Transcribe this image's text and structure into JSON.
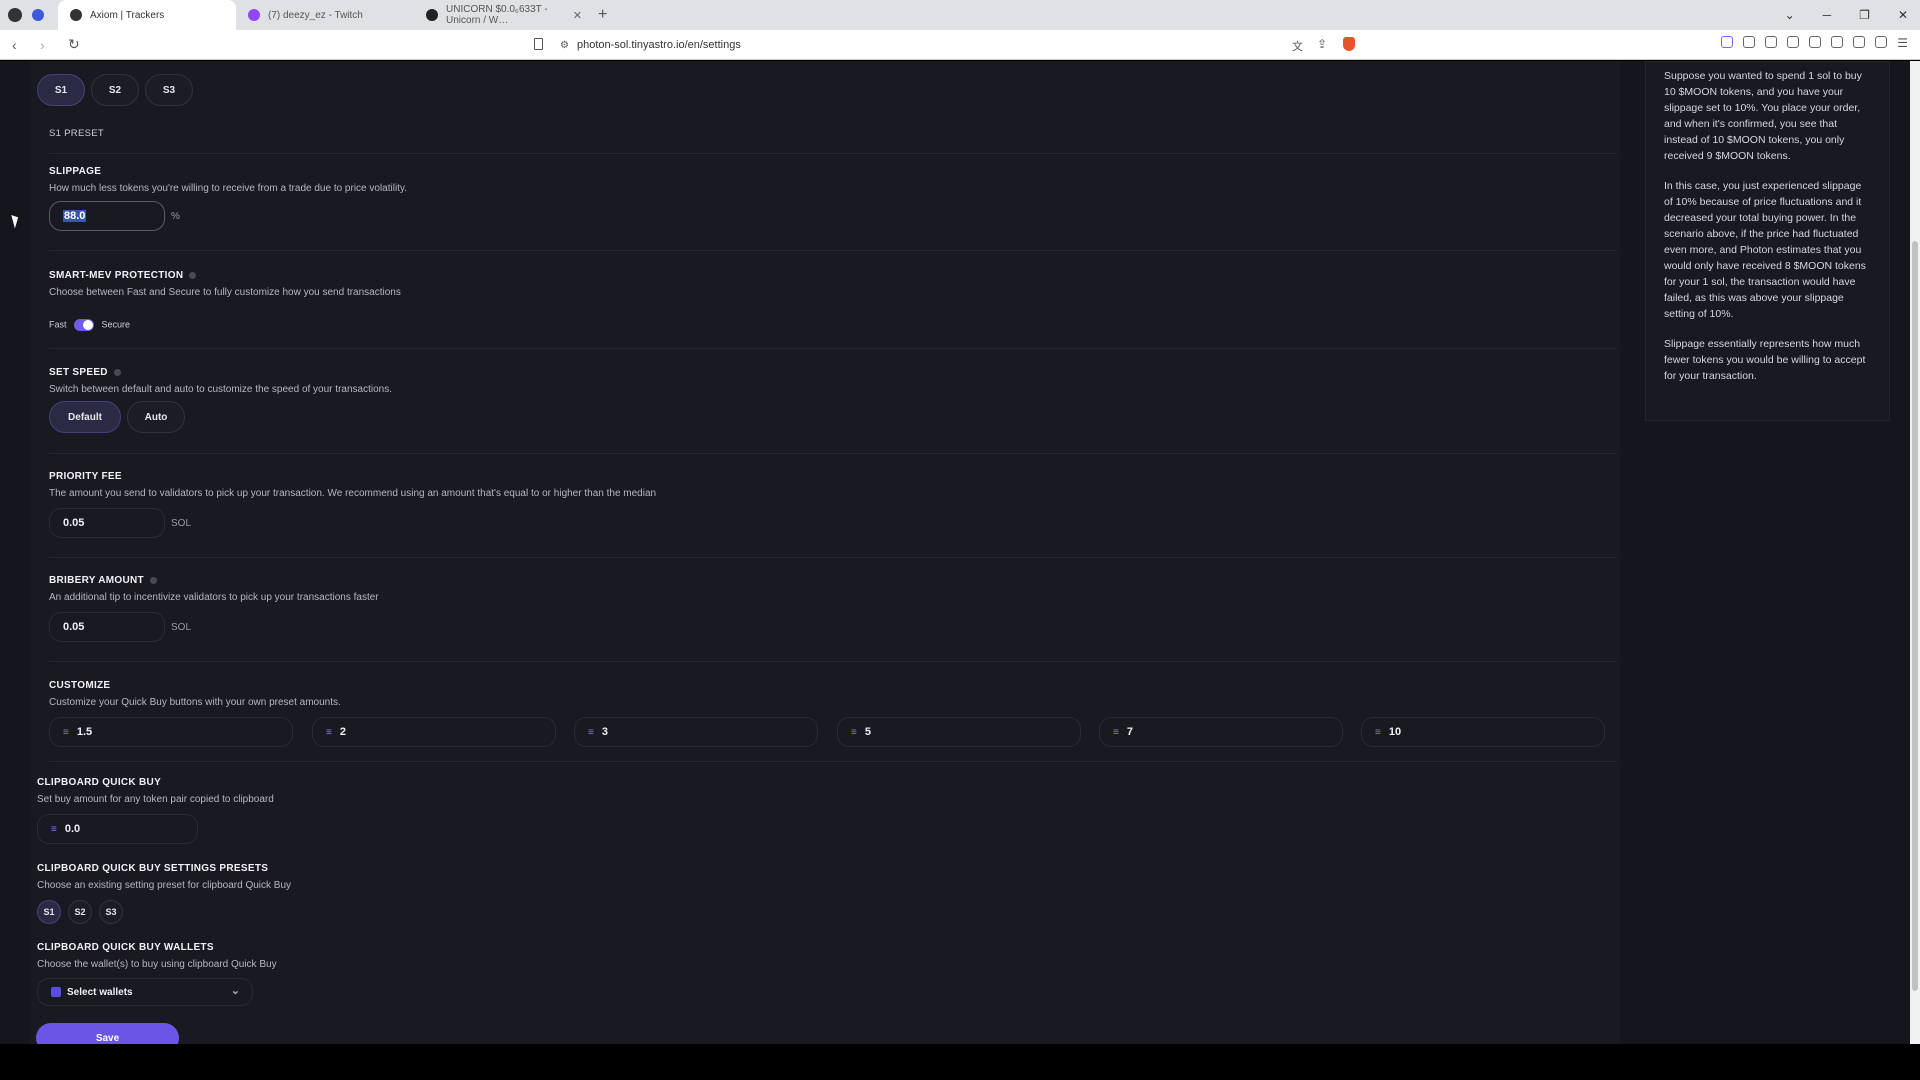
{
  "browser": {
    "tabs": [
      {
        "title": "Axiom | Trackers",
        "favicon_color": "#333333"
      },
      {
        "title": "(7) deezy_ez - Twitch",
        "favicon_color": "#9146ff"
      },
      {
        "title": "UNICORN $0.0₆633T - Unicorn / W…",
        "favicon_color": "#222222"
      }
    ],
    "url": "photon-sol.tinyastro.io/en/settings"
  },
  "presets": {
    "items": [
      "S1",
      "S2",
      "S3"
    ],
    "selected": "S1",
    "current_label": "S1 PRESET"
  },
  "slippage": {
    "title": "SLIPPAGE",
    "desc": "How much less tokens you're willing to receive from a trade due to price volatility.",
    "value": "88.0",
    "unit": "%"
  },
  "mev": {
    "title": "SMART-MEV PROTECTION",
    "desc": "Choose between Fast and Secure to fully customize how you send transactions",
    "left_label": "Fast",
    "right_label": "Secure",
    "mode": "Secure"
  },
  "speed": {
    "title": "SET SPEED",
    "desc": "Switch between default and auto to customize the speed of your transactions.",
    "options": [
      "Default",
      "Auto"
    ],
    "selected": "Default"
  },
  "priority_fee": {
    "title": "PRIORITY FEE",
    "desc": "The amount you send to validators to pick up your transaction. We recommend using an amount that's equal to or higher than the median",
    "value": "0.05",
    "unit": "SOL"
  },
  "bribery": {
    "title": "BRIBERY AMOUNT",
    "desc": "An additional tip to incentivize validators to pick up your transactions faster",
    "value": "0.05",
    "unit": "SOL"
  },
  "customize": {
    "title": "CUSTOMIZE",
    "desc": "Customize your Quick Buy buttons with your own preset amounts.",
    "amounts": [
      "1.5",
      "2",
      "3",
      "5",
      "7",
      "10"
    ]
  },
  "clipboard": {
    "title": "CLIPBOARD QUICK BUY",
    "desc": "Set buy amount for any token pair copied to clipboard",
    "value": "0.0"
  },
  "clipboard_presets": {
    "title": "CLIPBOARD QUICK BUY SETTINGS PRESETS",
    "desc": "Choose an existing setting preset for clipboard Quick Buy",
    "items": [
      "S1",
      "S2",
      "S3"
    ]
  },
  "clipboard_wallets": {
    "title": "CLIPBOARD QUICK BUY WALLETS",
    "desc": "Choose the wallet(s) to buy using clipboard Quick Buy",
    "placeholder": "Select wallets"
  },
  "save_label": "Save",
  "sidebar": {
    "paragraphs": [
      "Suppose you wanted to spend 1 sol to buy 10 $MOON tokens, and you have your slippage set to 10%. You place your order, and when it's confirmed, you see that instead of 10 $MOON tokens, you only received 9 $MOON tokens.",
      "In this case, you just experienced slippage of 10% because of price fluctuations and it decreased your total buying power. In the scenario above, if the price had fluctuated even more, and Photon estimates that you would only have received 8 $MOON tokens for your 1 sol, the transaction would have failed, as this was above your slippage setting of 10%.",
      "Slippage essentially represents how much fewer tokens you would be willing to accept for your transaction."
    ]
  },
  "colors": {
    "accent": "#6a55e6",
    "background": "#191921"
  }
}
